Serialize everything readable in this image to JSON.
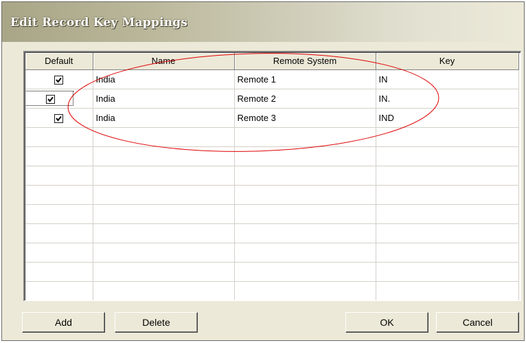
{
  "window": {
    "title": "Edit Record Key Mappings"
  },
  "grid": {
    "columns": [
      "Default",
      "Name",
      "Remote System",
      "Key"
    ],
    "rows": [
      {
        "default": true,
        "name": "India",
        "remote_system": "Remote 1",
        "key": "IN"
      },
      {
        "default": true,
        "name": "India",
        "remote_system": "Remote 2",
        "key": "IN."
      },
      {
        "default": true,
        "name": "India",
        "remote_system": "Remote 3",
        "key": "IND"
      }
    ],
    "annotation_color": "#e00000"
  },
  "buttons": {
    "add": "Add",
    "delete": "Delete",
    "ok": "OK",
    "cancel": "Cancel"
  }
}
